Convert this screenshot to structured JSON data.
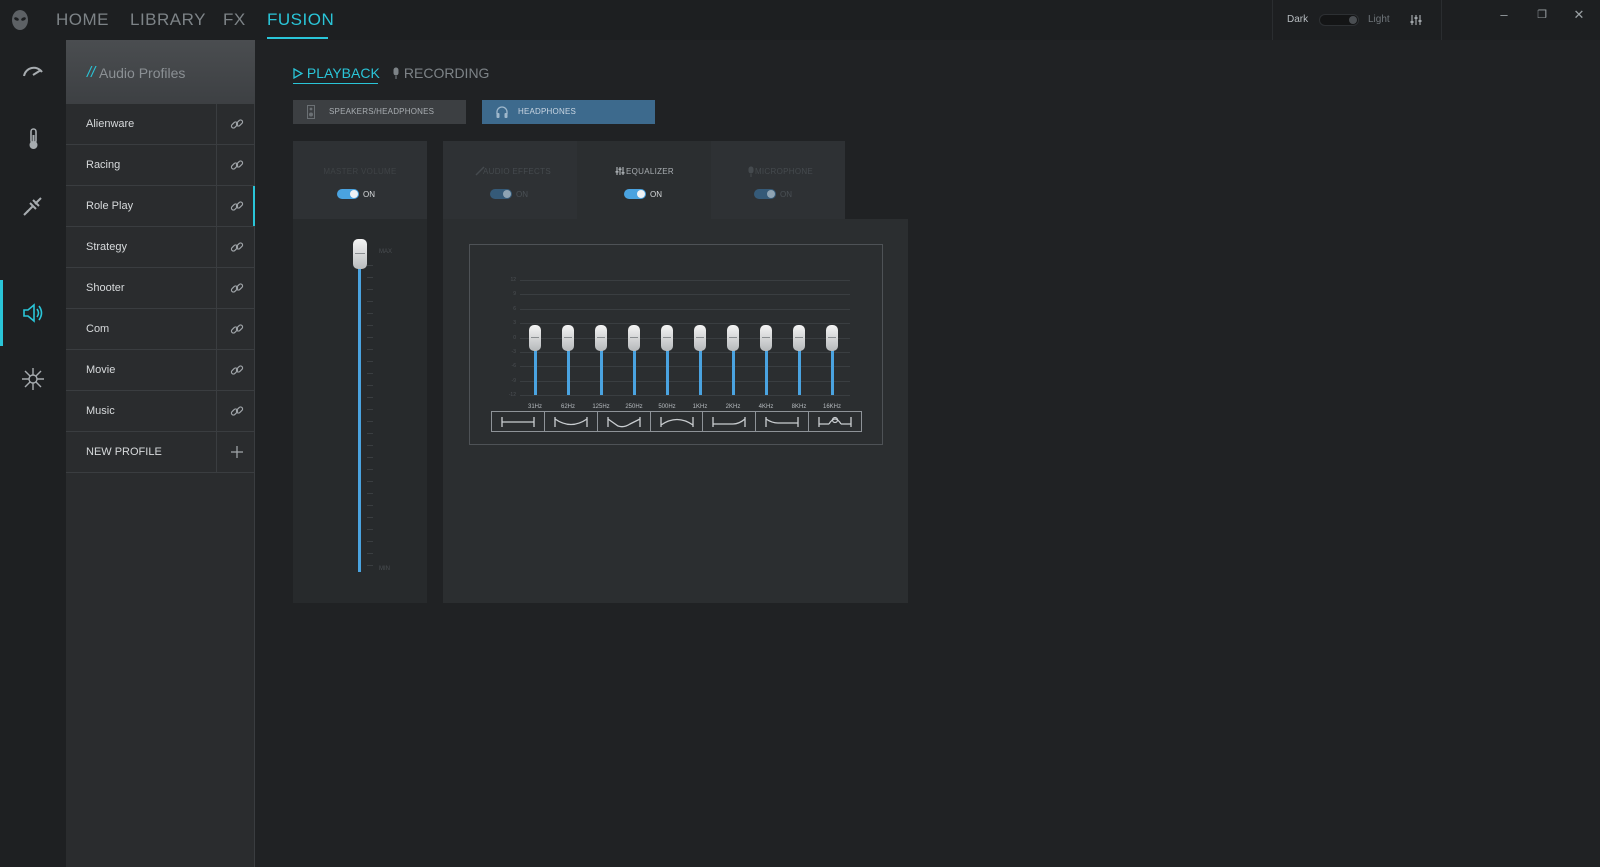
{
  "nav": {
    "tabs": [
      {
        "label": "HOME"
      },
      {
        "label": "LIBRARY"
      },
      {
        "label": "FX"
      },
      {
        "label": "FUSION"
      }
    ],
    "active": "FUSION",
    "theme_dark": "Dark",
    "theme_light": "Light"
  },
  "window_controls": {
    "minimize": "–",
    "restore": "❐",
    "close": "✕"
  },
  "rail": {
    "items": [
      "performance-icon",
      "thermal-icon",
      "power-icon",
      "audio-icon",
      "lighting-icon"
    ],
    "active": "audio-icon"
  },
  "profiles": {
    "slash": "//",
    "title": "Audio Profiles",
    "items": [
      "Alienware",
      "Racing",
      "Role Play",
      "Strategy",
      "Shooter",
      "Com",
      "Movie",
      "Music",
      "NEW PROFILE"
    ],
    "active": "Role Play"
  },
  "audio_tabs": {
    "playback": "PLAYBACK",
    "recording": "RECORDING",
    "active": "PLAYBACK"
  },
  "devices": {
    "speakers": "SPEAKERS/HEADPHONES",
    "headphones": "HEADPHONES",
    "active": "HEADPHONES"
  },
  "master": {
    "title": "MASTER VOLUME",
    "toggle": "ON",
    "max": "MAX",
    "min": "MIN",
    "volume_level": 1.0
  },
  "fx_tabs": [
    {
      "title": "AUDIO EFFECTS",
      "toggle": "ON",
      "enabled": false
    },
    {
      "title": "EQUALIZER",
      "toggle": "ON",
      "enabled": true
    },
    {
      "title": "MICROPHONE",
      "toggle": "ON",
      "enabled": false
    }
  ],
  "fx_active": "EQUALIZER",
  "equalizer": {
    "scale": [
      "12",
      "9",
      "6",
      "3",
      "0",
      "-3",
      "-6",
      "-9",
      "-12"
    ],
    "bands": [
      "31Hz",
      "62Hz",
      "125Hz",
      "250Hz",
      "500Hz",
      "1KHz",
      "2KHz",
      "4KHz",
      "8KHz",
      "16KHz"
    ],
    "gains_db": [
      0,
      0,
      0,
      0,
      0,
      0,
      0,
      0,
      0,
      0
    ],
    "presets": [
      "flat-preset-icon",
      "bass-treble-preset-icon",
      "v-shape-preset-icon",
      "mid-boost-preset-icon",
      "treble-rise-preset-icon",
      "bass-rise-preset-icon",
      "voice-preset-icon"
    ]
  },
  "colors": {
    "accent": "#2ac5d8",
    "slider": "#4aa3e0",
    "selected_device": "#3d6a8d"
  }
}
